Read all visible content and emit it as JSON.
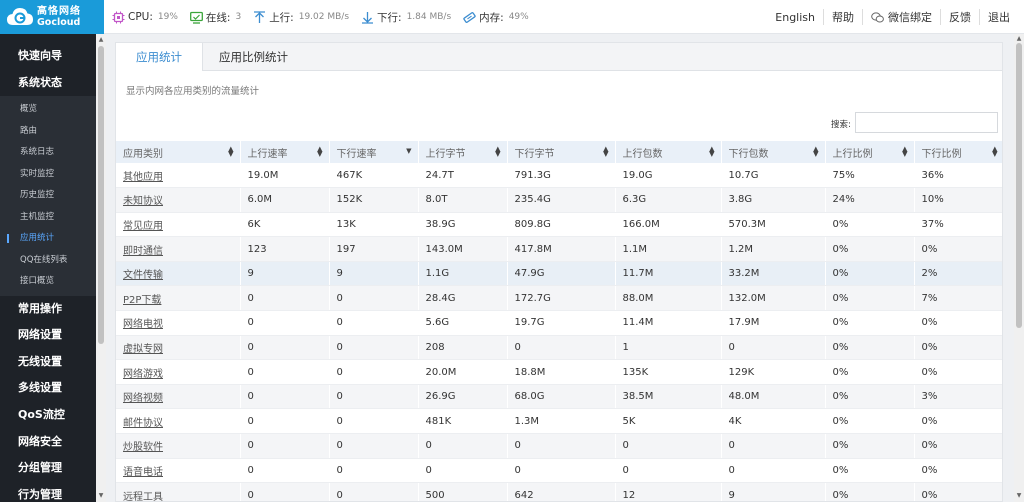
{
  "brand": {
    "cn": "高恪网络",
    "en": "Gocloud",
    "color": "#1a9bd9"
  },
  "stats": [
    {
      "icon": "cpu-icon",
      "label": "CPU:",
      "value": "19%"
    },
    {
      "icon": "online-users-icon",
      "label": "在线:",
      "value": "3"
    },
    {
      "icon": "upload-arrow-icon",
      "label": "上行:",
      "value": "19.02 MB/s"
    },
    {
      "icon": "download-arrow-icon",
      "label": "下行:",
      "value": "1.84 MB/s"
    },
    {
      "icon": "memory-icon",
      "label": "内存:",
      "value": "49%"
    }
  ],
  "toplinks": {
    "english": "English",
    "help": "帮助",
    "wechat": "微信绑定",
    "feedback": "反馈",
    "logout": "退出"
  },
  "sidebar": {
    "top": [
      "快速向导",
      "系统状态"
    ],
    "sub": [
      "概览",
      "路由",
      "系统日志",
      "实时监控",
      "历史监控",
      "主机监控",
      "应用统计",
      "QQ在线列表",
      "接口概览"
    ],
    "active_sub": 6,
    "bottom": [
      "常用操作",
      "网络设置",
      "无线设置",
      "多线设置",
      "QoS流控",
      "网络安全",
      "分组管理",
      "行为管理"
    ]
  },
  "tabs": [
    "应用统计",
    "应用比例统计"
  ],
  "description": "显示内网各应用类别的流量统计",
  "search_label": "搜索:",
  "table": {
    "headers": [
      "应用类别",
      "上行速率",
      "下行速率",
      "上行字节",
      "下行字节",
      "上行包数",
      "下行包数",
      "上行比例",
      "下行比例"
    ],
    "rows": [
      [
        "其他应用",
        "19.0M",
        "467K",
        "24.7T",
        "791.3G",
        "19.0G",
        "10.7G",
        "75%",
        "36%"
      ],
      [
        "未知协议",
        "6.0M",
        "152K",
        "8.0T",
        "235.4G",
        "6.3G",
        "3.8G",
        "24%",
        "10%"
      ],
      [
        "常见应用",
        "6K",
        "13K",
        "38.9G",
        "809.8G",
        "166.0M",
        "570.3M",
        "0%",
        "37%"
      ],
      [
        "即时通信",
        "123",
        "197",
        "143.0M",
        "417.8M",
        "1.1M",
        "1.2M",
        "0%",
        "0%"
      ],
      [
        "文件传输",
        "9",
        "9",
        "1.1G",
        "47.9G",
        "11.7M",
        "33.2M",
        "0%",
        "2%"
      ],
      [
        "P2P下载",
        "0",
        "0",
        "28.4G",
        "172.7G",
        "88.0M",
        "132.0M",
        "0%",
        "7%"
      ],
      [
        "网络电视",
        "0",
        "0",
        "5.6G",
        "19.7G",
        "11.4M",
        "17.9M",
        "0%",
        "0%"
      ],
      [
        "虚拟专网",
        "0",
        "0",
        "208",
        "0",
        "1",
        "0",
        "0%",
        "0%"
      ],
      [
        "网络游戏",
        "0",
        "0",
        "20.0M",
        "18.8M",
        "135K",
        "129K",
        "0%",
        "0%"
      ],
      [
        "网络视频",
        "0",
        "0",
        "26.9G",
        "68.0G",
        "38.5M",
        "48.0M",
        "0%",
        "3%"
      ],
      [
        "邮件协议",
        "0",
        "0",
        "481K",
        "1.3M",
        "5K",
        "4K",
        "0%",
        "0%"
      ],
      [
        "炒股软件",
        "0",
        "0",
        "0",
        "0",
        "0",
        "0",
        "0%",
        "0%"
      ],
      [
        "语音电话",
        "0",
        "0",
        "0",
        "0",
        "0",
        "0",
        "0%",
        "0%"
      ],
      [
        "远程工具",
        "0",
        "0",
        "500",
        "642",
        "12",
        "9",
        "0%",
        "0%"
      ]
    ]
  }
}
